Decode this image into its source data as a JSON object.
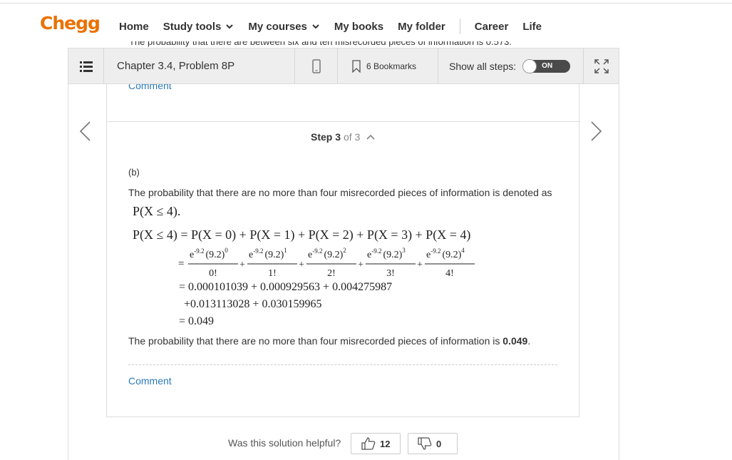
{
  "brand": {
    "logo": "Chegg",
    "color": "#eb7100"
  },
  "nav": {
    "home": "Home",
    "study_tools": "Study tools",
    "my_courses": "My courses",
    "my_books": "My books",
    "my_folder": "My folder",
    "career": "Career",
    "life": "Life"
  },
  "clipped_text": "The probability that there are between six and ten misrecorded pieces of information is 0.573.",
  "toolbar": {
    "chapter": "Chapter 3.4, Problem 8P",
    "bookmarks": "6 Bookmarks",
    "show_steps": "Show all steps:",
    "toggle": "ON"
  },
  "upper_comment": "Comment",
  "step": {
    "label": "Step 3",
    "of": "of 3"
  },
  "content": {
    "part": "(b)",
    "intro": "The probability that there are no more than four misrecorded pieces of information is denoted as",
    "conclusion_prefix": "The probability that there are no more than four misrecorded pieces of information is ",
    "conclusion_value": "0.049",
    "conclusion_suffix": "."
  },
  "math": {
    "notation": "P(X ≤ 4).",
    "line1": "P(X ≤ 4) = P(X = 0) + P(X = 1) + P(X = 2) + P(X = 3) + P(X = 4)",
    "terms": [
      {
        "num": "e^-9.2 (9.2)^0",
        "den": "0!"
      },
      {
        "num": "e^-9.2 (9.2)^1",
        "den": "1!"
      },
      {
        "num": "e^-9.2 (9.2)^2",
        "den": "2!"
      },
      {
        "num": "e^-9.2 (9.2)^3",
        "den": "3!"
      },
      {
        "num": "e^-9.2 (9.2)^4",
        "den": "4!"
      }
    ],
    "line3": "= 0.000101039 + 0.000929563 + 0.004275987",
    "line4": "+0.013113028 + 0.030159965",
    "line5": "= 0.049"
  },
  "comment": "Comment",
  "feedback": {
    "question": "Was this solution helpful?",
    "up_count": "12",
    "down_count": "0"
  }
}
